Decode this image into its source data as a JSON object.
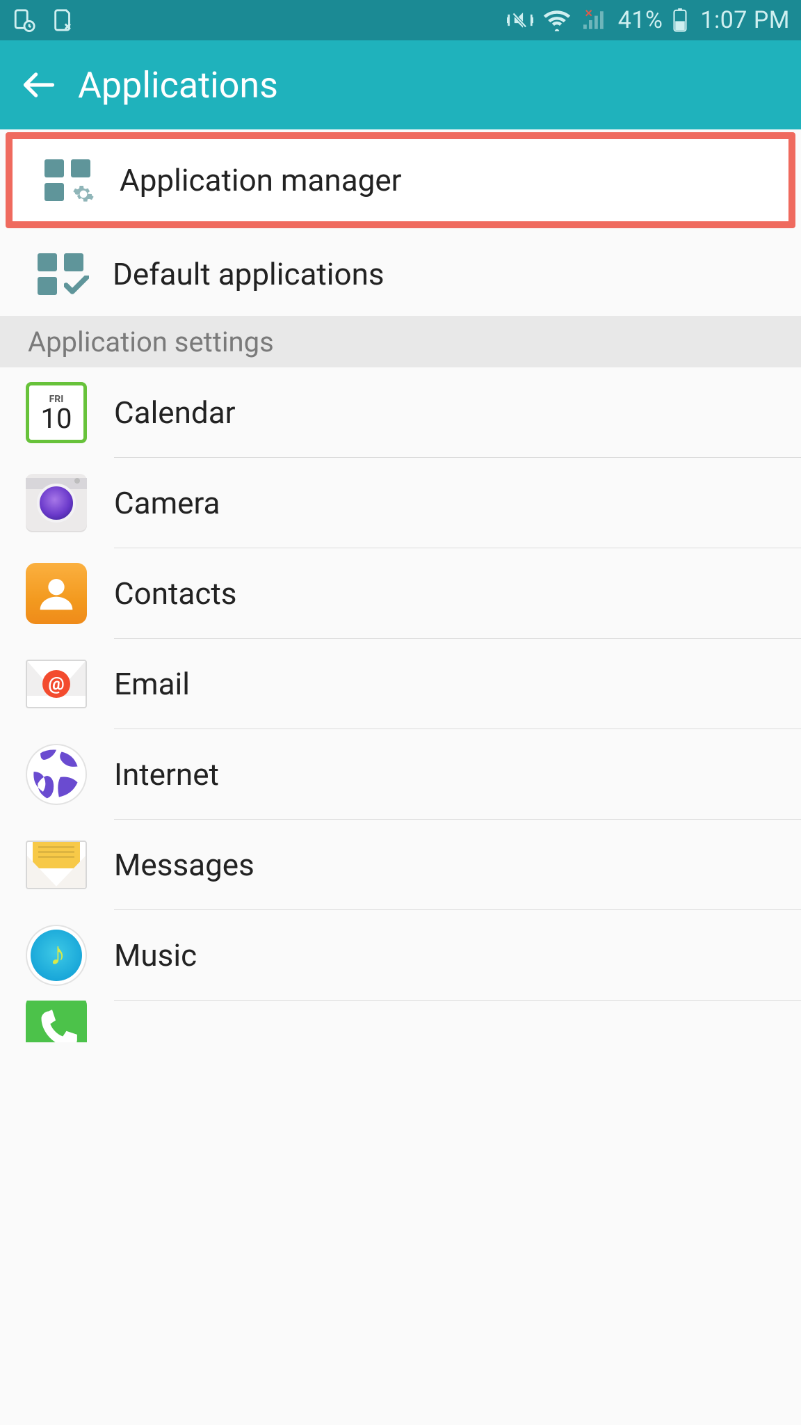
{
  "status": {
    "battery_pct": "41%",
    "time": "1:07 PM"
  },
  "header": {
    "title": "Applications"
  },
  "top_menu": [
    {
      "label": "Application manager",
      "icon": "grid-gear"
    },
    {
      "label": "Default applications",
      "icon": "grid-check"
    }
  ],
  "section_header": "Application settings",
  "apps": [
    {
      "label": "Calendar",
      "icon": "calendar",
      "cal_day": "FRI",
      "cal_num": "10"
    },
    {
      "label": "Camera",
      "icon": "camera"
    },
    {
      "label": "Contacts",
      "icon": "contacts"
    },
    {
      "label": "Email",
      "icon": "email"
    },
    {
      "label": "Internet",
      "icon": "internet"
    },
    {
      "label": "Messages",
      "icon": "messages"
    },
    {
      "label": "Music",
      "icon": "music"
    }
  ]
}
